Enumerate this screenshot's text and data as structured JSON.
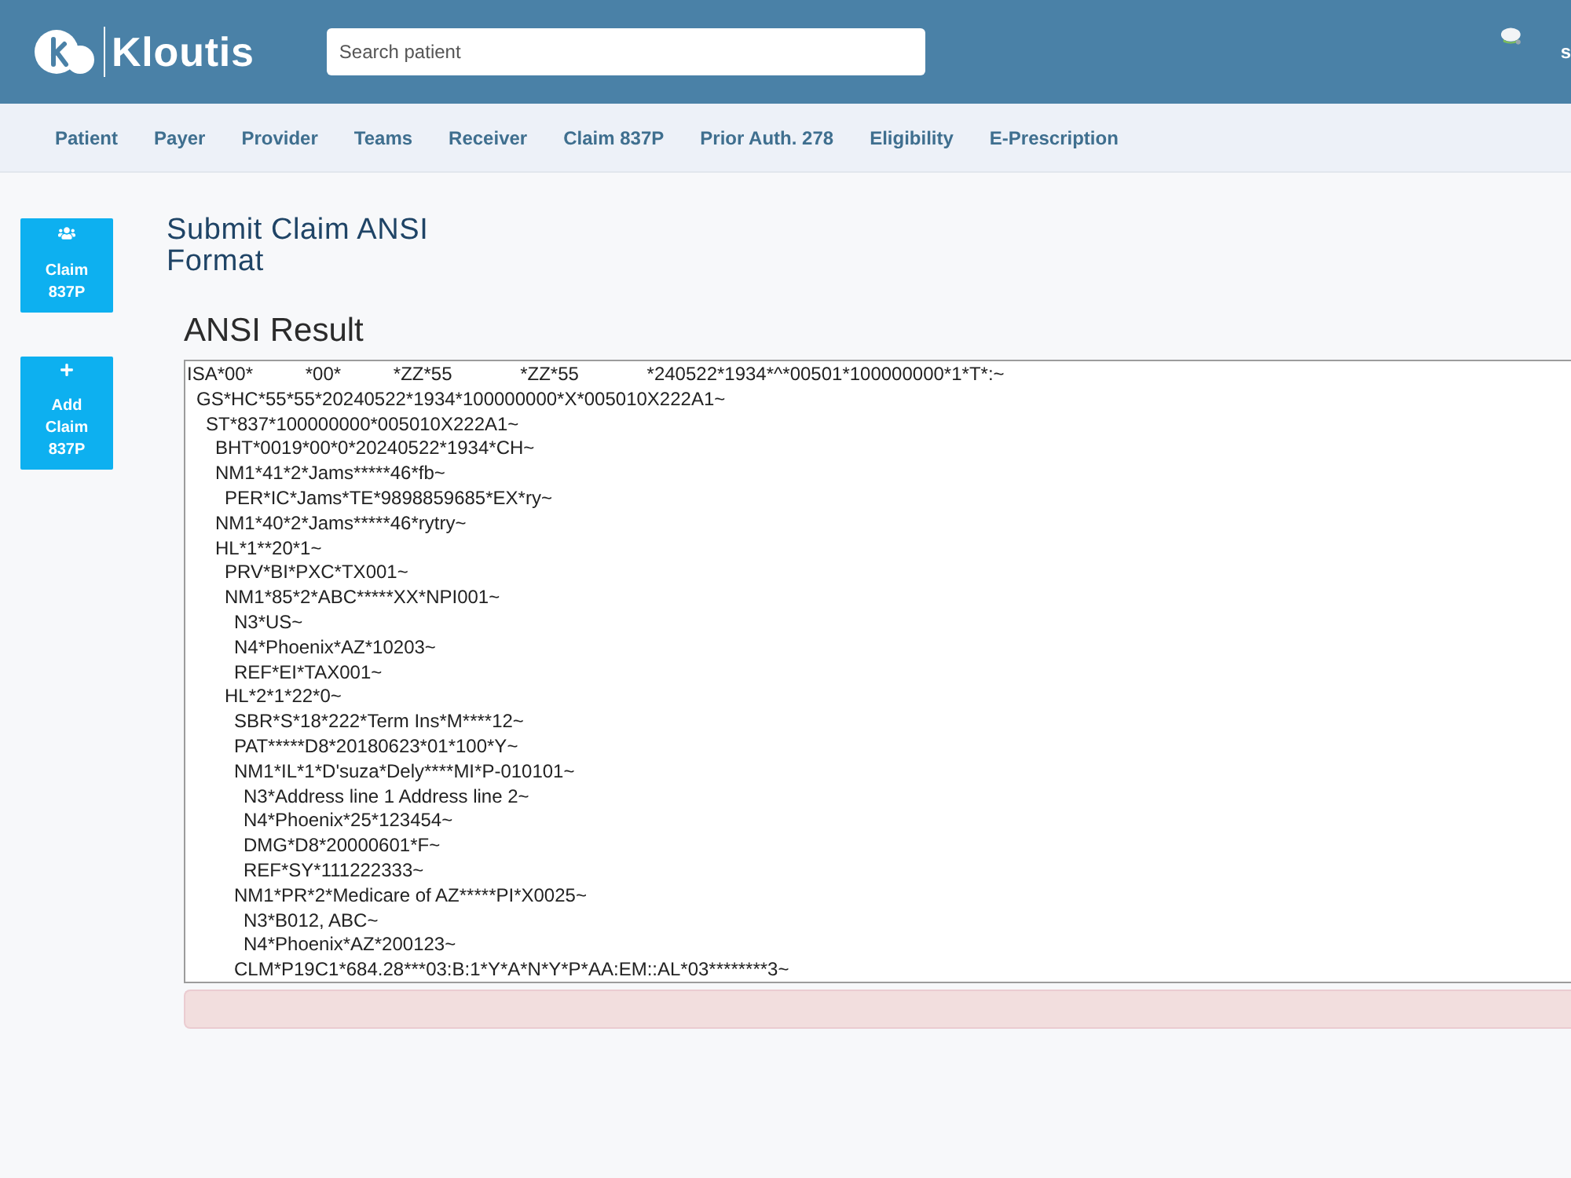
{
  "header": {
    "brand": "Kloutis",
    "search": {
      "placeholder": "Search patient"
    },
    "user": {
      "name": "s"
    }
  },
  "nav": {
    "items": [
      "Patient",
      "Payer",
      "Provider",
      "Teams",
      "Receiver",
      "Claim 837P",
      "Prior Auth. 278",
      "Eligibility",
      "E-Prescription"
    ]
  },
  "sidebar": {
    "buttons": [
      {
        "kind": "group",
        "label": "Claim 837P"
      },
      {
        "kind": "add",
        "label": "Add Claim 837P"
      }
    ]
  },
  "page": {
    "title": "Submit Claim ANSI Format"
  },
  "ansi_result": {
    "title": "ANSI Result",
    "segments": [
      {
        "text": "ISA*00*          *00*          *ZZ*55             *ZZ*55             *240522*1934*^*00501*100000000*1*T*:~",
        "children": [
          {
            "text": "GS*HC*55*55*20240522*1934*100000000*X*005010X222A1~",
            "children": [
              {
                "text": "ST*837*100000000*005010X222A1~",
                "children": [
                  {
                    "text": "BHT*0019*00*0*20240522*1934*CH~"
                  },
                  {
                    "text": "NM1*41*2*Jams*****46*fb~",
                    "children": [
                      {
                        "text": "PER*IC*Jams*TE*9898859685*EX*ry~"
                      }
                    ]
                  },
                  {
                    "text": "NM1*40*2*Jams*****46*rytry~"
                  },
                  {
                    "text": "HL*1**20*1~",
                    "children": [
                      {
                        "text": "PRV*BI*PXC*TX001~"
                      },
                      {
                        "text": "NM1*85*2*ABC*****XX*NPI001~",
                        "children": [
                          {
                            "text": "N3*US~"
                          },
                          {
                            "text": "N4*Phoenix*AZ*10203~"
                          },
                          {
                            "text": "REF*EI*TAX001~"
                          }
                        ]
                      },
                      {
                        "text": "HL*2*1*22*0~",
                        "children": [
                          {
                            "text": "SBR*S*18*222*Term Ins*M****12~"
                          },
                          {
                            "text": "PAT*****D8*20180623*01*100*Y~"
                          },
                          {
                            "text": "NM1*IL*1*D'suza*Dely****MI*P-010101~",
                            "children": [
                              {
                                "text": "N3*Address line 1 Address line 2~"
                              },
                              {
                                "text": "N4*Phoenix*25*123454~"
                              },
                              {
                                "text": "DMG*D8*20000601*F~"
                              },
                              {
                                "text": "REF*SY*111222333~"
                              }
                            ]
                          },
                          {
                            "text": "NM1*PR*2*Medicare of AZ*****PI*X0025~",
                            "children": [
                              {
                                "text": "N3*B012, ABC~"
                              },
                              {
                                "text": "N4*Phoenix*AZ*200123~"
                              }
                            ]
                          },
                          {
                            "text": "CLM*P19C1*684.28***03:B:1*Y*A*N*Y*P*AA:EM::AL*03********3~"
                          }
                        ]
                      }
                    ]
                  }
                ]
              }
            ]
          }
        ]
      }
    ]
  },
  "alert": {
    "kind": "error"
  }
}
